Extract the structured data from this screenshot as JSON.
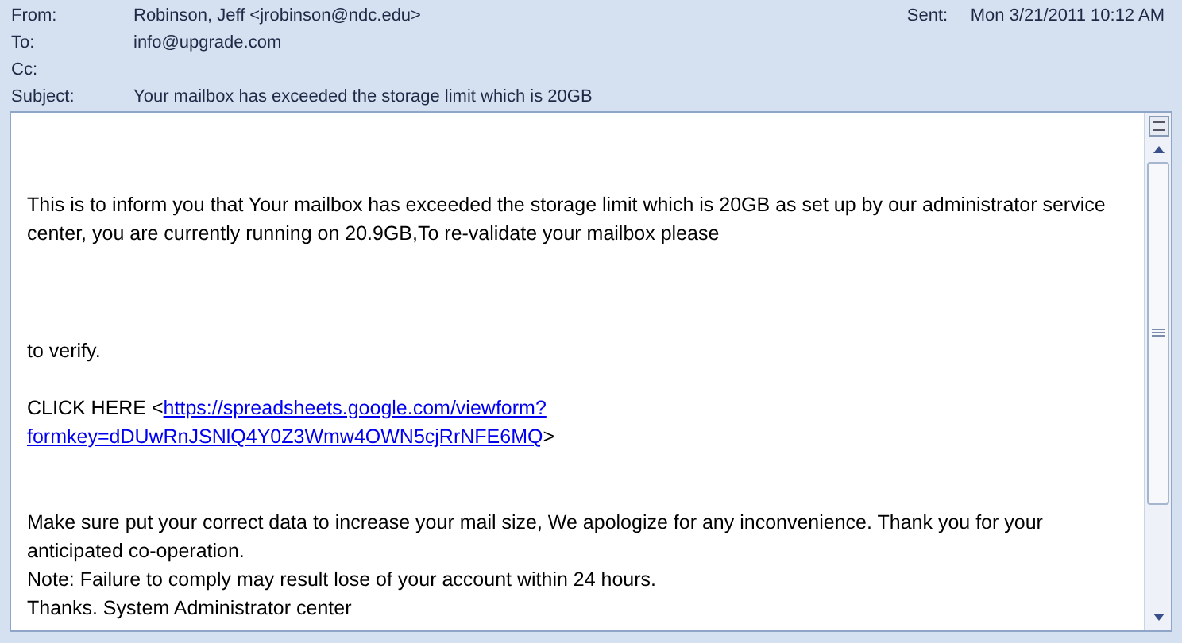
{
  "header": {
    "from": {
      "label": "From:",
      "value": "Robinson, Jeff <jrobinson@ndc.edu>"
    },
    "sent": {
      "label": "Sent:",
      "value": "Mon 3/21/2011 10:12 AM"
    },
    "to": {
      "label": "To:",
      "value": "info@upgrade.com"
    },
    "cc": {
      "label": "Cc:"
    },
    "subject": {
      "label": "Subject:",
      "value": "Your mailbox has exceeded the storage limit which is 20GB"
    }
  },
  "body": {
    "intro": "This is to inform you that Your mailbox has exceeded the storage limit which is 20GB as set up by our administrator service center, you are currently running on 20.9GB,To re-validate your mailbox  please",
    "verify": "to verify.",
    "link_prefix": "CLICK HERE <",
    "link_lines": [
      "https://spreadsheets.google.com/viewform?",
      "formkey=dDUwRnJSNlQ4Y0Z3Wmw4OWN5cjRrNFE6MQ"
    ],
    "link_suffix": ">",
    "closing": [
      "Make sure put your correct data  to increase your mail size, We apologize for any inconvenience. Thank you for your anticipated  co-operation.",
      "Note: Failure to comply may result lose of your account within 24 hours.",
      "Thanks. System Administrator center"
    ]
  }
}
